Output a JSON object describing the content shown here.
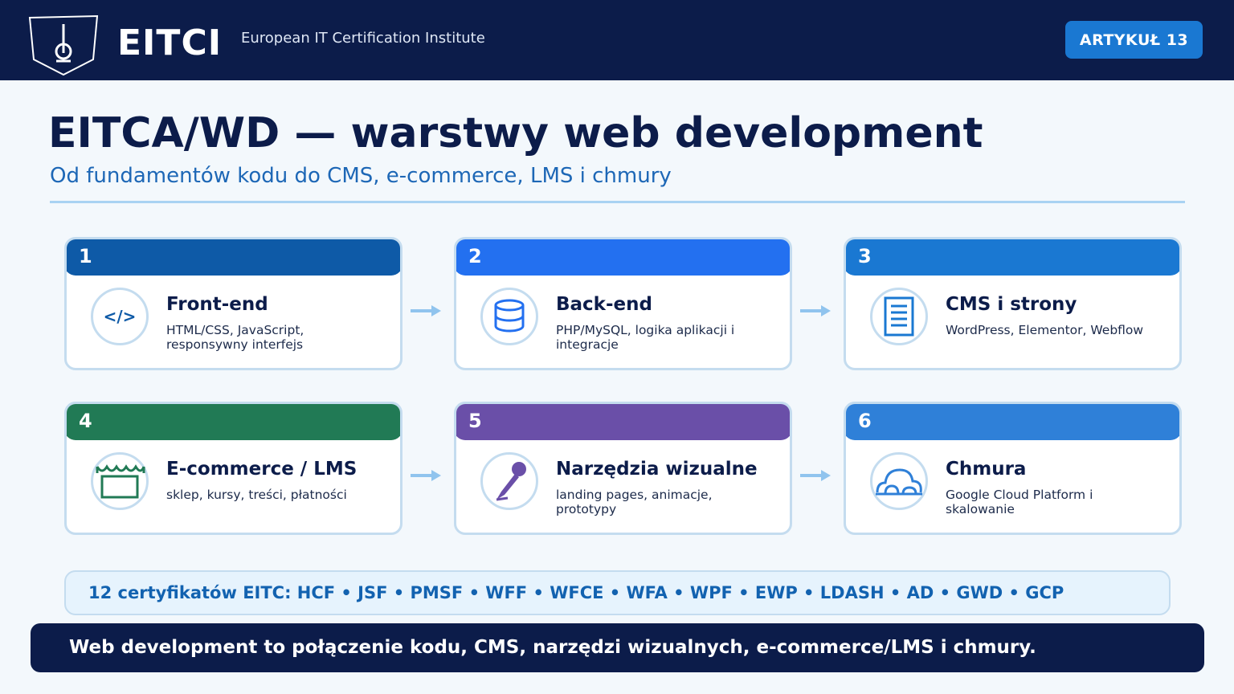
{
  "header": {
    "brand": "EITCI",
    "subtitle": "European IT Certification Institute",
    "badge": "ARTYKUŁ 13"
  },
  "title": "EITCA/WD — warstwy web development",
  "subtitle": "Od fundamentów kodu do CMS, e-commerce, LMS i chmury",
  "cards": [
    {
      "number": "1",
      "title": "Front-end",
      "desc": "HTML/CSS, JavaScript, responsywny interfejs",
      "icon": "code-icon",
      "color": "#0e5aa7"
    },
    {
      "number": "2",
      "title": "Back-end",
      "desc": "PHP/MySQL, logika aplikacji i integracje",
      "icon": "database-icon",
      "color": "#2370f0"
    },
    {
      "number": "3",
      "title": "CMS i strony",
      "desc": "WordPress, Elementor, Webflow",
      "icon": "document-icon",
      "color": "#1a78d2"
    },
    {
      "number": "4",
      "title": "E-commerce / LMS",
      "desc": "sklep, kursy, treści, płatności",
      "icon": "shop-icon",
      "color": "#217a55"
    },
    {
      "number": "5",
      "title": "Narzędzia wizualne",
      "desc": "landing pages, animacje, prototypy",
      "icon": "brush-icon",
      "color": "#6a4fa8"
    },
    {
      "number": "6",
      "title": "Chmura",
      "desc": "Google Cloud Platform i skalowanie",
      "icon": "cloud-icon",
      "color": "#2f80d8"
    }
  ],
  "certificates": "12 certyfikatów EITC: HCF • JSF • PMSF • WFF • WFCE • WFA • WPF • EWP • LDASH • AD • GWD • GCP",
  "footer": "Web development to połączenie kodu, CMS, narzędzi wizualnych, e-commerce/LMS i chmury."
}
